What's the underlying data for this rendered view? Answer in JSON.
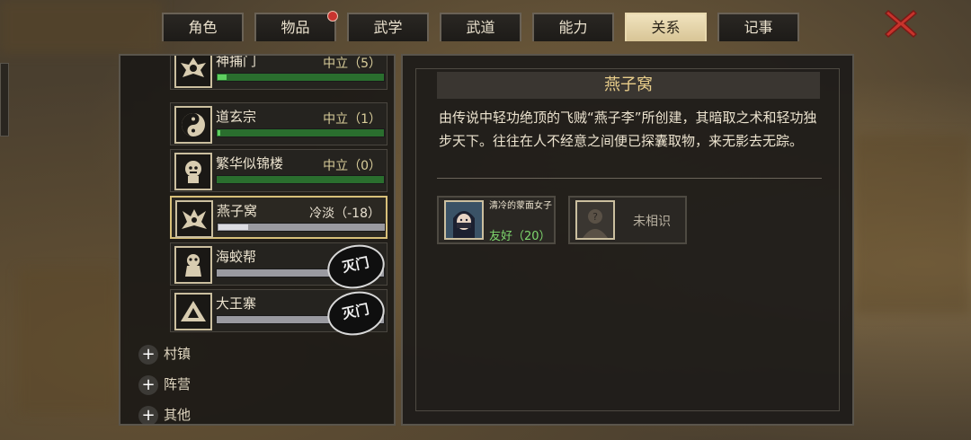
{
  "tabs": [
    {
      "label": "角色",
      "active": false,
      "badge": false
    },
    {
      "label": "物品",
      "active": false,
      "badge": true
    },
    {
      "label": "武学",
      "active": false,
      "badge": false
    },
    {
      "label": "武道",
      "active": false,
      "badge": false
    },
    {
      "label": "能力",
      "active": false,
      "badge": false
    },
    {
      "label": "关系",
      "active": true,
      "badge": false
    },
    {
      "label": "记事",
      "active": false,
      "badge": false
    }
  ],
  "factions": [
    {
      "name": "神捕门",
      "status": "中立（5）",
      "progress": 0.05,
      "bar": "green",
      "icon": "eagle-emblem-icon"
    },
    {
      "name": "道玄宗",
      "status": "中立（1）",
      "progress": 0.01,
      "bar": "green",
      "icon": "taiji-emblem-icon"
    },
    {
      "name": "繁华似锦楼",
      "status": "中立（0）",
      "progress": 0.0,
      "bar": "green",
      "icon": "lion-emblem-icon"
    },
    {
      "name": "燕子窝",
      "status": "冷淡（-18）",
      "progress": 0.18,
      "bar": "gray",
      "icon": "swallow-emblem-icon",
      "selected": true
    },
    {
      "name": "海蛟帮",
      "status": "",
      "progress": 0.0,
      "bar": "gray",
      "icon": "dragon-emblem-icon",
      "stamp": "灭门"
    },
    {
      "name": "大王寨",
      "status": "",
      "progress": 0.0,
      "bar": "gray",
      "icon": "mountain-emblem-icon",
      "stamp": "灭门"
    }
  ],
  "categories": [
    "村镇",
    "阵营",
    "其他"
  ],
  "detail": {
    "title": "燕子窝",
    "description": "由传说中轻功绝顶的飞贼“燕子李”所创建，其暗取之术和轻功独步天下。往往在人不经意之间便已探囊取物，来无影去无踪。"
  },
  "npcs": [
    {
      "name": "清冷的蒙面女子",
      "relation": "友好（20）"
    },
    {
      "name": "",
      "relation": "",
      "unknown_label": "未相识"
    }
  ]
}
